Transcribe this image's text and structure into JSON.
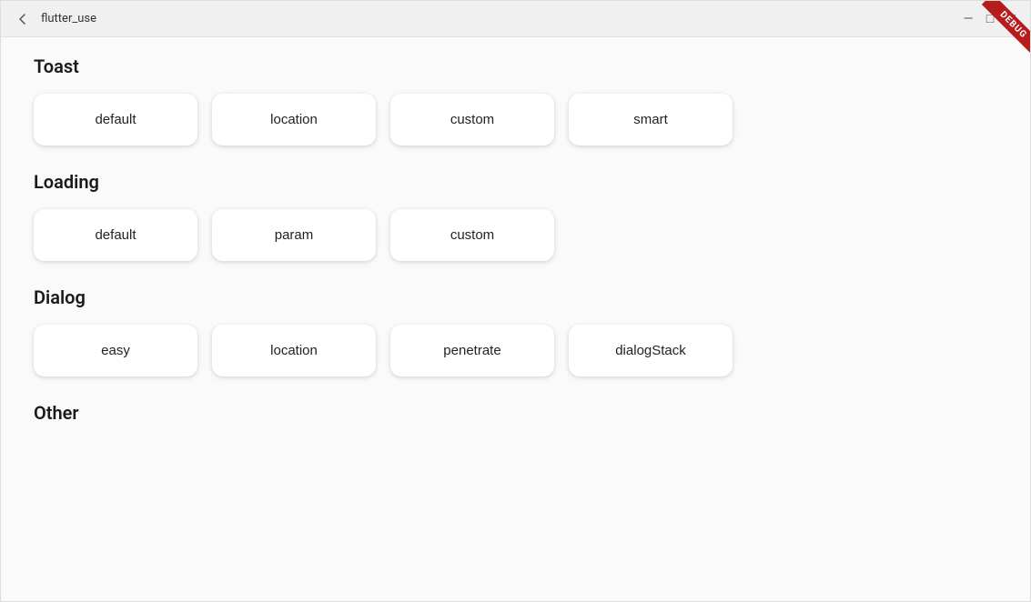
{
  "window": {
    "title": "flutter_use",
    "titlebar": {
      "back_label": "‹",
      "minimize_label": "—",
      "maximize_label": "□",
      "close_label": "✕"
    },
    "debug_badge": "DEBUG"
  },
  "sections": [
    {
      "id": "toast",
      "title": "Toast",
      "buttons": [
        {
          "id": "toast-default",
          "label": "default"
        },
        {
          "id": "toast-location",
          "label": "location"
        },
        {
          "id": "toast-custom",
          "label": "custom"
        },
        {
          "id": "toast-smart",
          "label": "smart"
        }
      ]
    },
    {
      "id": "loading",
      "title": "Loading",
      "buttons": [
        {
          "id": "loading-default",
          "label": "default"
        },
        {
          "id": "loading-param",
          "label": "param"
        },
        {
          "id": "loading-custom",
          "label": "custom"
        }
      ]
    },
    {
      "id": "dialog",
      "title": "Dialog",
      "buttons": [
        {
          "id": "dialog-easy",
          "label": "easy"
        },
        {
          "id": "dialog-location",
          "label": "location"
        },
        {
          "id": "dialog-penetrate",
          "label": "penetrate"
        },
        {
          "id": "dialog-stack",
          "label": "dialogStack"
        }
      ]
    },
    {
      "id": "other",
      "title": "Other",
      "buttons": []
    }
  ]
}
